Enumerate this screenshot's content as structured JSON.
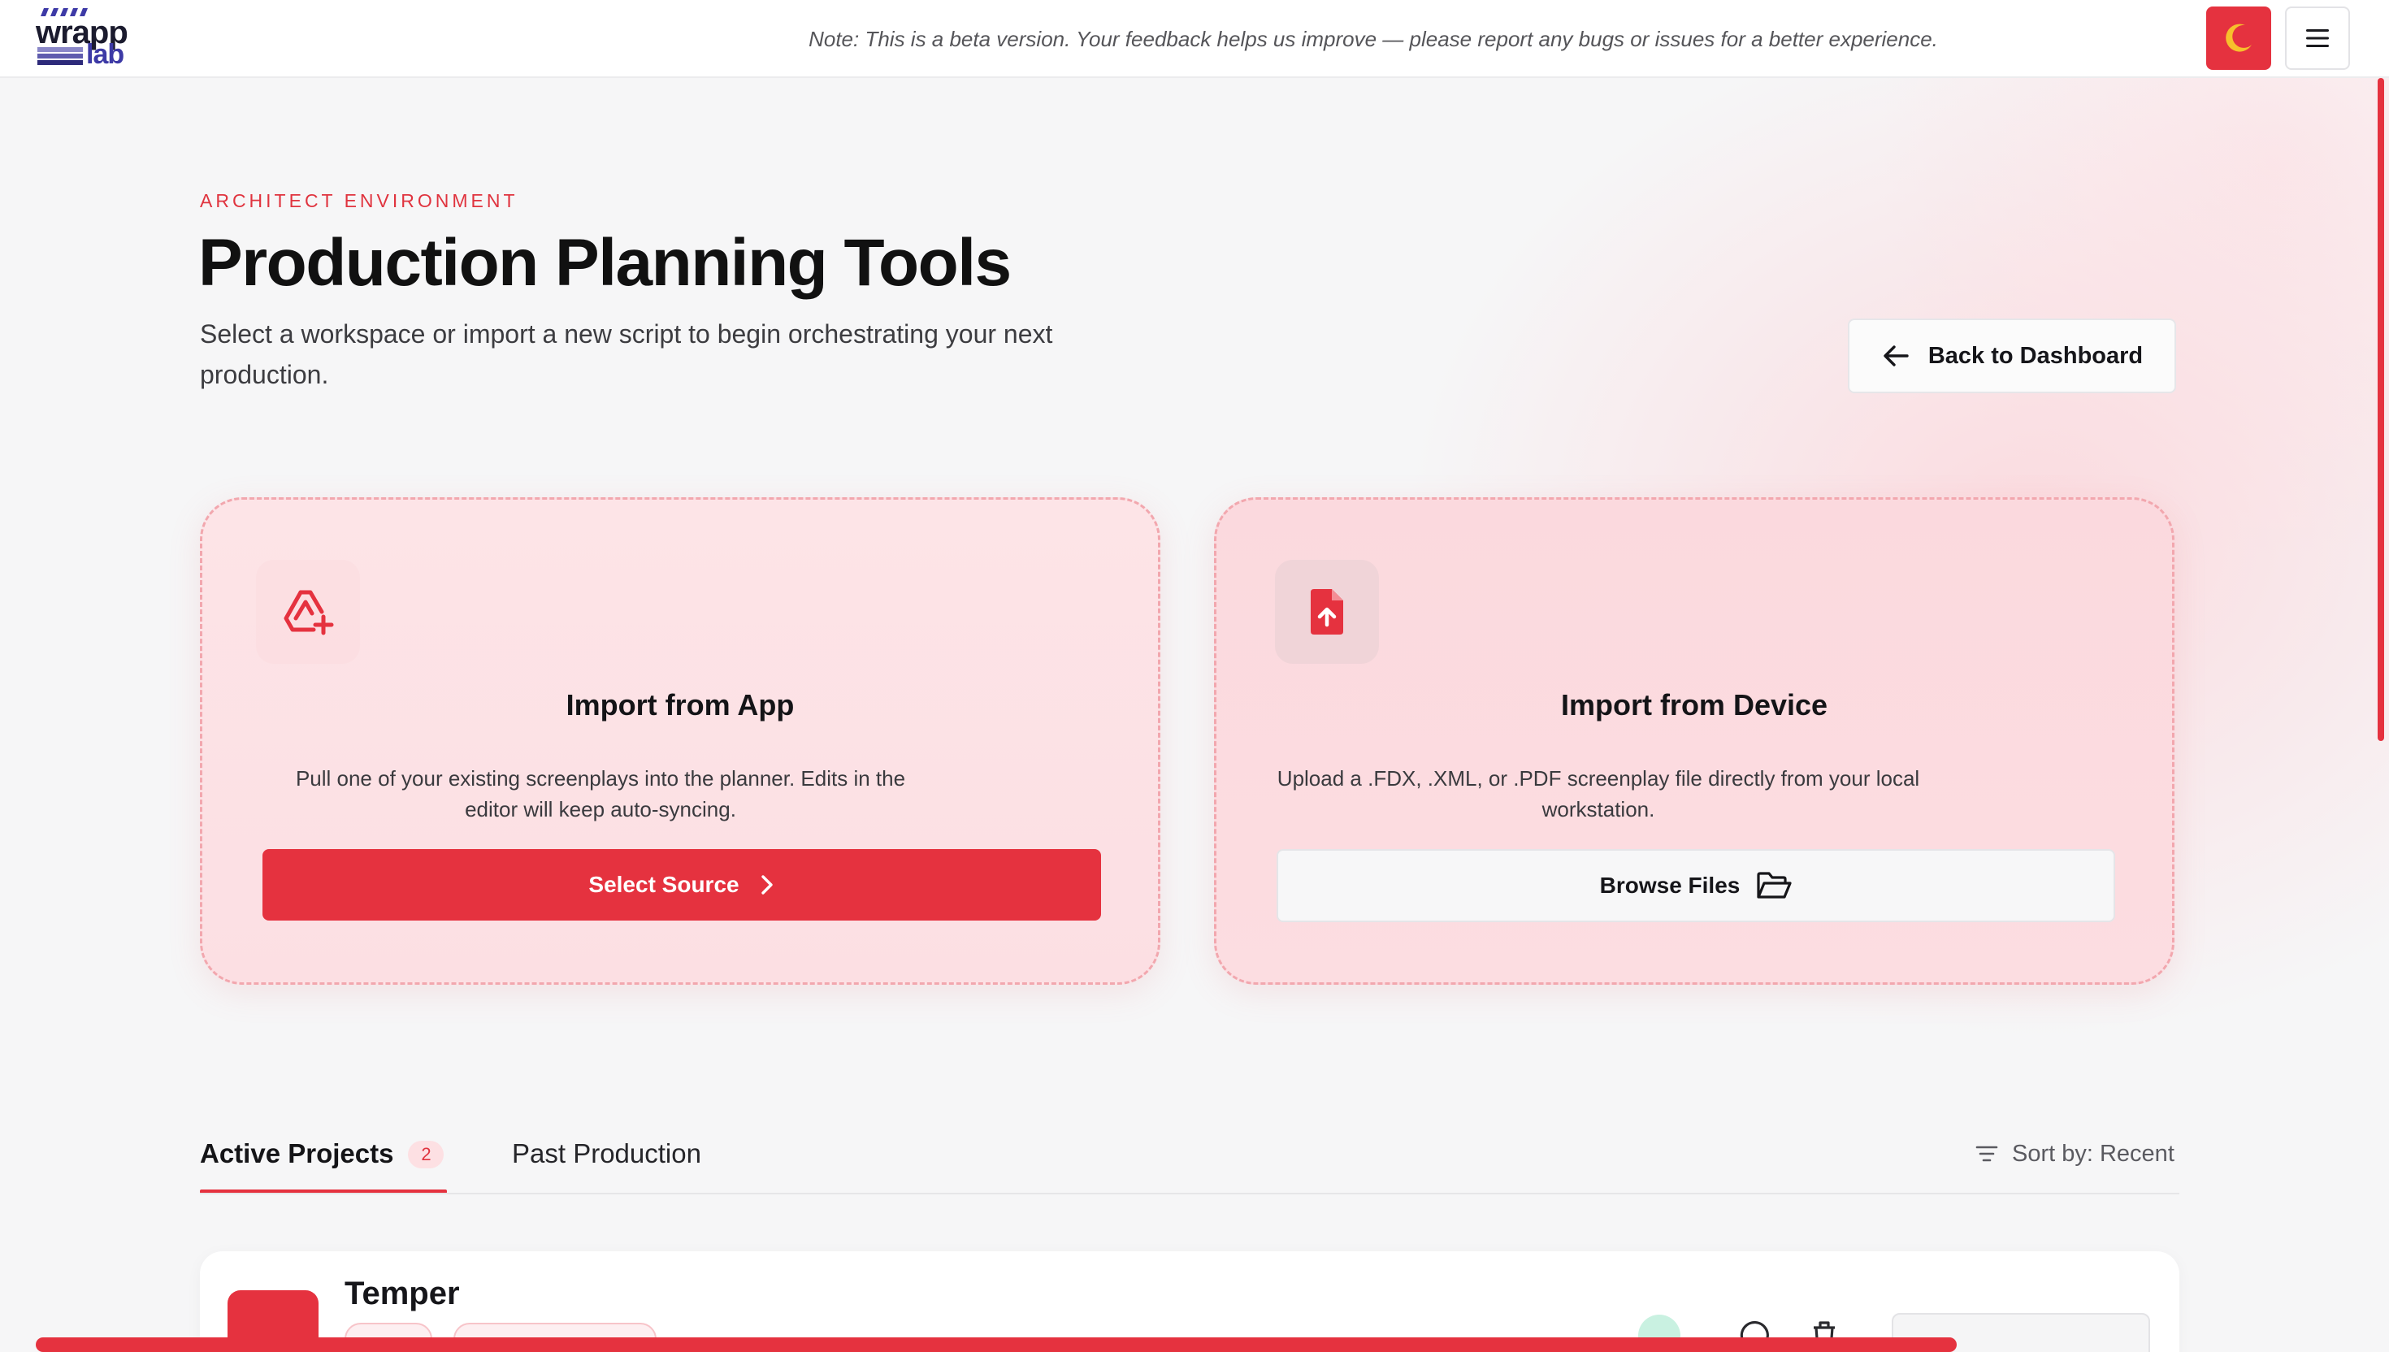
{
  "brand": {
    "logo_line1": "wrapp",
    "logo_line2": "lab"
  },
  "beta_note": "Note: This is a beta version. Your feedback helps us improve — please report any bugs or issues for a better experience.",
  "header": {
    "theme_icon": "moon-icon",
    "menu_icon": "hamburger-menu-icon"
  },
  "hero": {
    "eyebrow": "ARCHITECT ENVIRONMENT",
    "title": "Production Planning Tools",
    "subtitle": "Select a workspace or import a new script to begin orchestrating your next production.",
    "back_button": "Back to Dashboard"
  },
  "cards": {
    "app": {
      "icon": "drive-add-icon",
      "title": "Import from App",
      "description": "Pull one of your existing screenplays into the planner. Edits in the editor will keep auto-syncing.",
      "button": "Select Source"
    },
    "device": {
      "icon": "file-upload-icon",
      "title": "Import from Device",
      "description": "Upload a .FDX, .XML, or .PDF screenplay file directly from your local workstation.",
      "button": "Browse Files"
    }
  },
  "tabs": {
    "active_label": "Active Projects",
    "active_count": "2",
    "past_label": "Past Production",
    "sort_label": "Sort by: Recent"
  },
  "projects": [
    {
      "name": "Temper"
    }
  ],
  "colors": {
    "accent": "#e5323f",
    "card_border": "#f2a7ae",
    "text": "#121212"
  }
}
